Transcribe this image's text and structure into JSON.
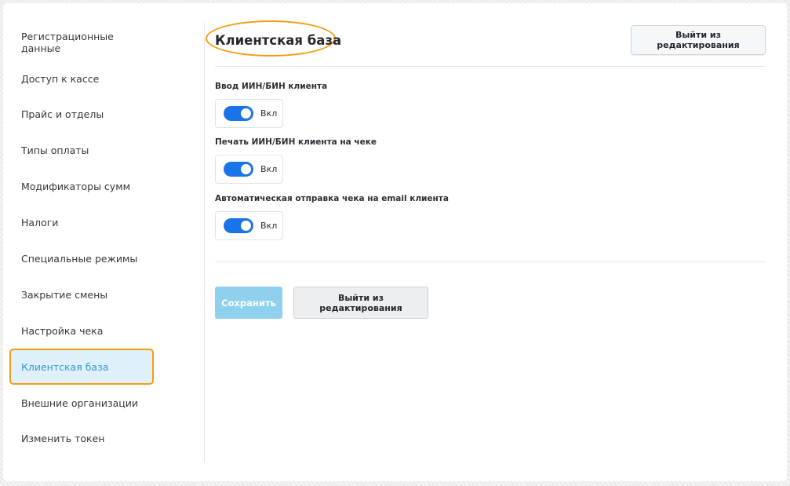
{
  "sidebar": {
    "items": [
      {
        "label": "Регистрационные данные"
      },
      {
        "label": "Доступ к кассе"
      },
      {
        "label": "Прайс и отделы"
      },
      {
        "label": "Типы оплаты"
      },
      {
        "label": "Модификаторы сумм"
      },
      {
        "label": "Налоги"
      },
      {
        "label": "Специальные режимы"
      },
      {
        "label": "Закрытие смены"
      },
      {
        "label": "Настройка чека"
      },
      {
        "label": "Клиентская база"
      },
      {
        "label": "Внешние организации"
      },
      {
        "label": "Изменить токен"
      }
    ],
    "active_item": "Клиентская база"
  },
  "main": {
    "title": "Клиентская база",
    "exit_edit_top_label": "Выйти из редактирования",
    "settings": [
      {
        "label": "Ввод ИИН/БИН клиента",
        "toggle_state": "Вкл",
        "enabled": true
      },
      {
        "label": "Печать ИИН/БИН клиента на чеке",
        "toggle_state": "Вкл",
        "enabled": true
      },
      {
        "label": "Автоматическая отправка чека на email клиента",
        "toggle_state": "Вкл",
        "enabled": true
      }
    ],
    "save_label": "Сохранить",
    "exit_edit_bottom_label": "Выйти из редактирования"
  },
  "colors": {
    "accent_blue": "#1a73e8",
    "active_nav_text": "#2f9bd3",
    "active_nav_bg": "#dff0fb",
    "highlight_orange": "#f39c12",
    "save_button_bg": "#8ed0ee"
  }
}
